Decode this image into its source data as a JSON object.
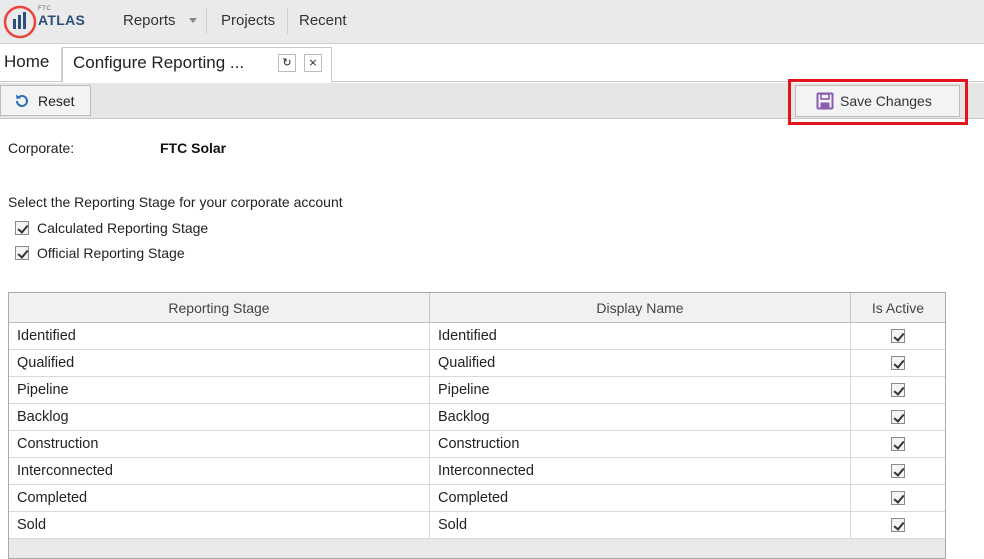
{
  "app": {
    "logo_small": "FTC",
    "logo_text": "ATLAS"
  },
  "nav": {
    "items": [
      {
        "label": "Reports"
      },
      {
        "label": "Projects"
      },
      {
        "label": "Recent"
      }
    ]
  },
  "tabs": {
    "home_label": "Home",
    "active_label": "Configure Reporting ...",
    "refresh_icon": "↻",
    "close_icon": "×"
  },
  "toolbar": {
    "reset_label": "Reset",
    "save_label": "Save Changes",
    "highlight_color": "#e0151d"
  },
  "form": {
    "corporate_label": "Corporate:",
    "corporate_value": "FTC Solar",
    "select_prompt": "Select the Reporting Stage for your corporate account",
    "options": [
      {
        "label": "Calculated Reporting Stage",
        "checked": true
      },
      {
        "label": "Official Reporting Stage",
        "checked": true
      }
    ]
  },
  "table": {
    "headers": [
      "Reporting Stage",
      "Display Name",
      "Is Active"
    ],
    "rows": [
      {
        "stage": "Identified",
        "display": "Identified",
        "active": true
      },
      {
        "stage": "Qualified",
        "display": "Qualified",
        "active": true
      },
      {
        "stage": "Pipeline",
        "display": "Pipeline",
        "active": true
      },
      {
        "stage": "Backlog",
        "display": "Backlog",
        "active": true
      },
      {
        "stage": "Construction",
        "display": "Construction",
        "active": true
      },
      {
        "stage": "Interconnected",
        "display": "Interconnected",
        "active": true
      },
      {
        "stage": "Completed",
        "display": "Completed",
        "active": true
      },
      {
        "stage": "Sold",
        "display": "Sold",
        "active": true
      }
    ]
  }
}
